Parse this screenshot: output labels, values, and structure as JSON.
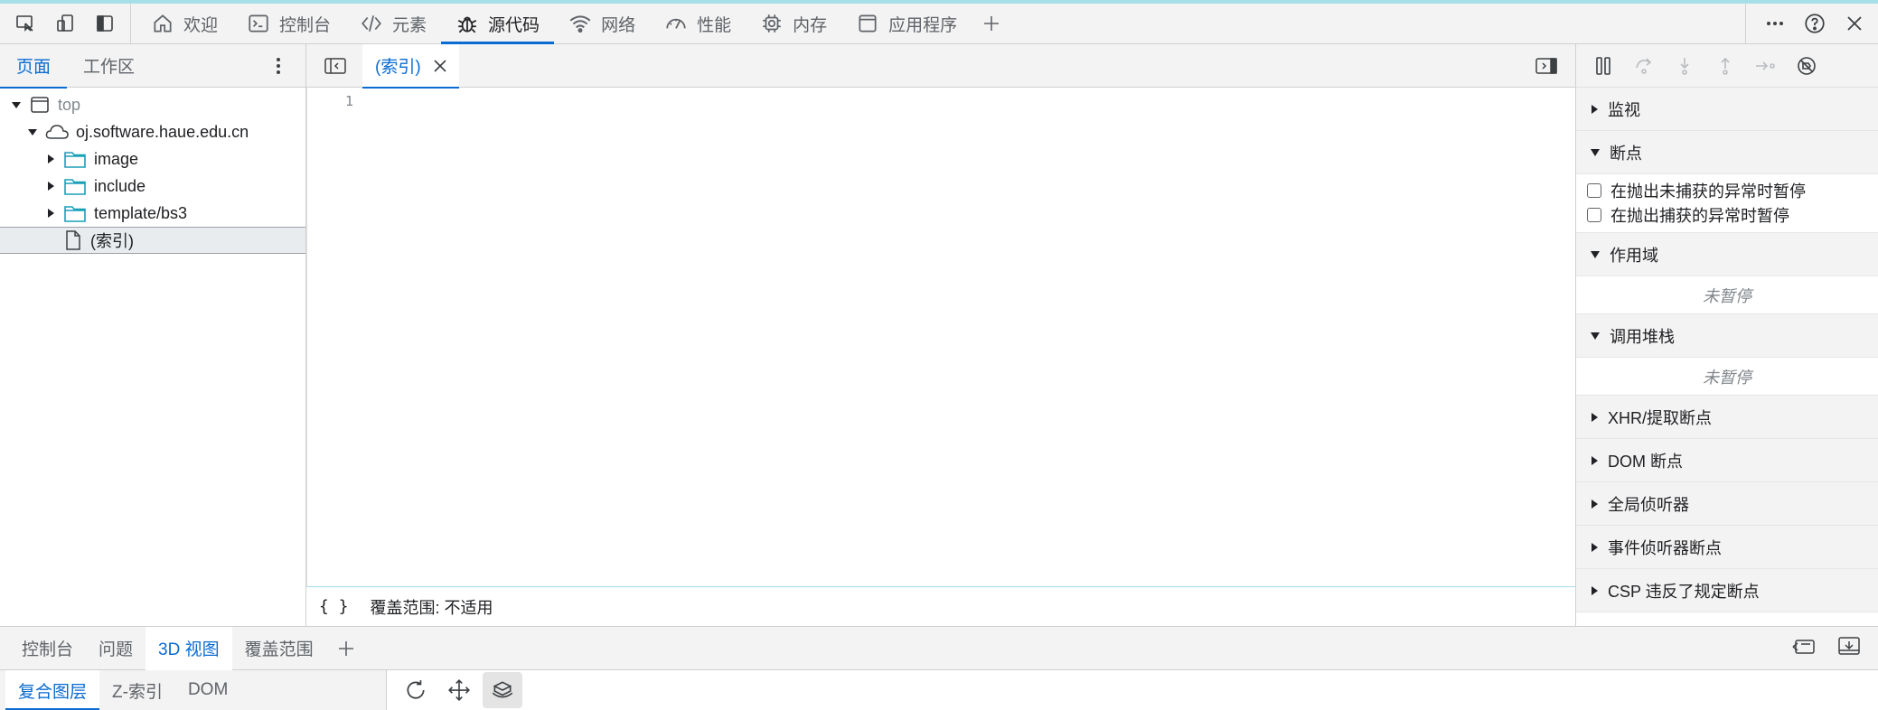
{
  "main_tabs": [
    {
      "label": "欢迎",
      "icon": "home-icon"
    },
    {
      "label": "控制台",
      "icon": "console-icon"
    },
    {
      "label": "元素",
      "icon": "code-tag-icon"
    },
    {
      "label": "源代码",
      "icon": "bug-icon",
      "active": true
    },
    {
      "label": "网络",
      "icon": "wifi-icon"
    },
    {
      "label": "性能",
      "icon": "gauge-icon"
    },
    {
      "label": "内存",
      "icon": "chip-icon"
    },
    {
      "label": "应用程序",
      "icon": "window-icon"
    }
  ],
  "navigator": {
    "tabs": [
      "页面",
      "工作区"
    ],
    "tree": {
      "top": "top",
      "domain": "oj.software.haue.edu.cn",
      "folders": [
        "image",
        "include",
        "template/bs3"
      ],
      "file": "(索引)"
    }
  },
  "editor": {
    "tab_label": "(索引)",
    "line_number": "1",
    "braces": "{ }",
    "coverage": "覆盖范围: 不适用"
  },
  "debugger": {
    "watch": "监视",
    "breakpoints": "断点",
    "pause_uncaught": "在抛出未捕获的异常时暂停",
    "pause_caught": "在抛出捕获的异常时暂停",
    "scope": "作用域",
    "scope_state": "未暂停",
    "call_stack": "调用堆栈",
    "call_stack_state": "未暂停",
    "xhr": "XHR/提取断点",
    "dom": "DOM 断点",
    "global": "全局侦听器",
    "event": "事件侦听器断点",
    "csp": "CSP 违反了规定断点"
  },
  "drawer": {
    "tabs": [
      "控制台",
      "问题",
      "3D 视图",
      "覆盖范围"
    ],
    "active_tab": "3D 视图",
    "sub_tabs": [
      "复合图层",
      "Z-索引",
      "DOM"
    ]
  },
  "colors": {
    "accent": "#0a6cd1",
    "toolbar_bg": "#f3f3f3",
    "folder": "#1a9fb8"
  }
}
